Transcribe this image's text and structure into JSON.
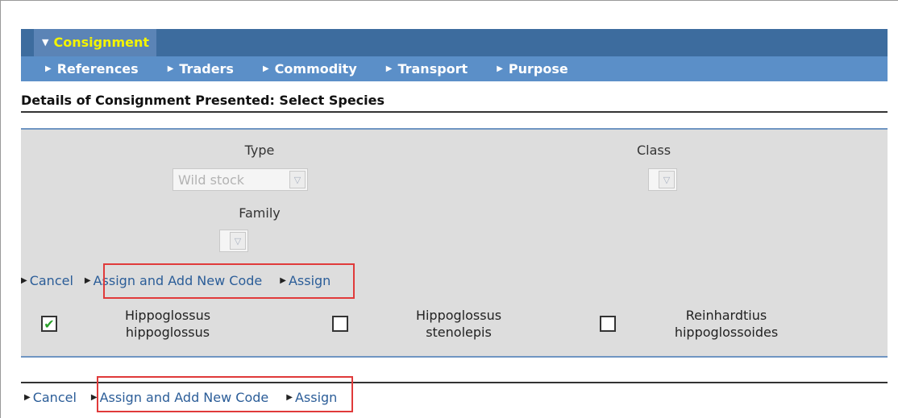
{
  "tabs": {
    "active": "Consignment",
    "sub": [
      {
        "label": "References"
      },
      {
        "label": "Traders"
      },
      {
        "label": "Commodity"
      },
      {
        "label": "Transport"
      },
      {
        "label": "Purpose"
      }
    ]
  },
  "page_title": "Details of Consignment Presented: Select Species",
  "filters": {
    "type": {
      "label": "Type",
      "value": "Wild stock"
    },
    "class": {
      "label": "Class",
      "value": ""
    },
    "family": {
      "label": "Family",
      "value": ""
    }
  },
  "actions": {
    "cancel": "Cancel",
    "assign_add": "Assign and Add New Code",
    "assign": "Assign"
  },
  "species": [
    {
      "line1": "Hippoglossus",
      "line2": "hippoglossus",
      "checked": true
    },
    {
      "line1": "Hippoglossus",
      "line2": "stenolepis",
      "checked": false
    },
    {
      "line1": "Reinhardtius",
      "line2": "hippoglossoides",
      "checked": false
    }
  ],
  "colors": {
    "tab_bar": "#3d6c9e",
    "active_tab_text": "#f4f400",
    "sub_bar": "#5b8fc8",
    "panel_bg": "#dddddd",
    "highlight": "#e03a3a",
    "check": "#2aa02a"
  },
  "icons": {
    "tab_expanded": "triangle-down-icon",
    "tab_collapsed": "triangle-right-icon",
    "dropdown": "chevron-down-icon",
    "checkmark": "check-icon"
  }
}
